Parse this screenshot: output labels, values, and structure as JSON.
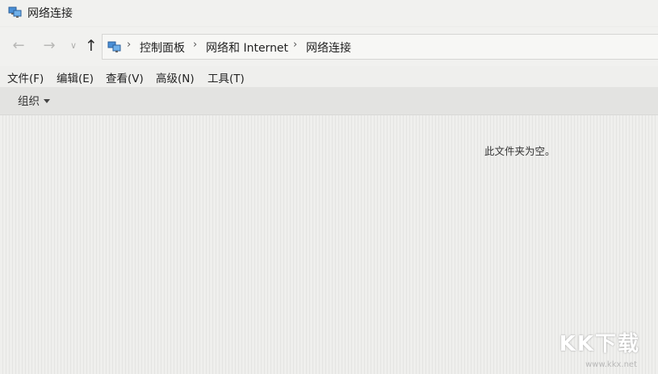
{
  "window": {
    "title": "网络连接"
  },
  "nav": {
    "back_glyph": "←",
    "forward_glyph": "→",
    "recent_glyph": "∨",
    "up_glyph": "↑"
  },
  "address": {
    "crumbs": [
      "控制面板",
      "网络和 Internet",
      "网络连接"
    ],
    "separator": "›"
  },
  "menubar": {
    "items": [
      "文件(F)",
      "编辑(E)",
      "查看(V)",
      "高级(N)",
      "工具(T)"
    ]
  },
  "commandbar": {
    "organize_label": "组织"
  },
  "content": {
    "empty_message": "此文件夹为空。"
  },
  "watermark": {
    "logo_text": "KK下载",
    "url": "www.kkx.net"
  },
  "colors": {
    "content_bg": "#efefed",
    "commandbar_bg": "#e3e3e1",
    "address_bg": "#f7f7f5"
  }
}
